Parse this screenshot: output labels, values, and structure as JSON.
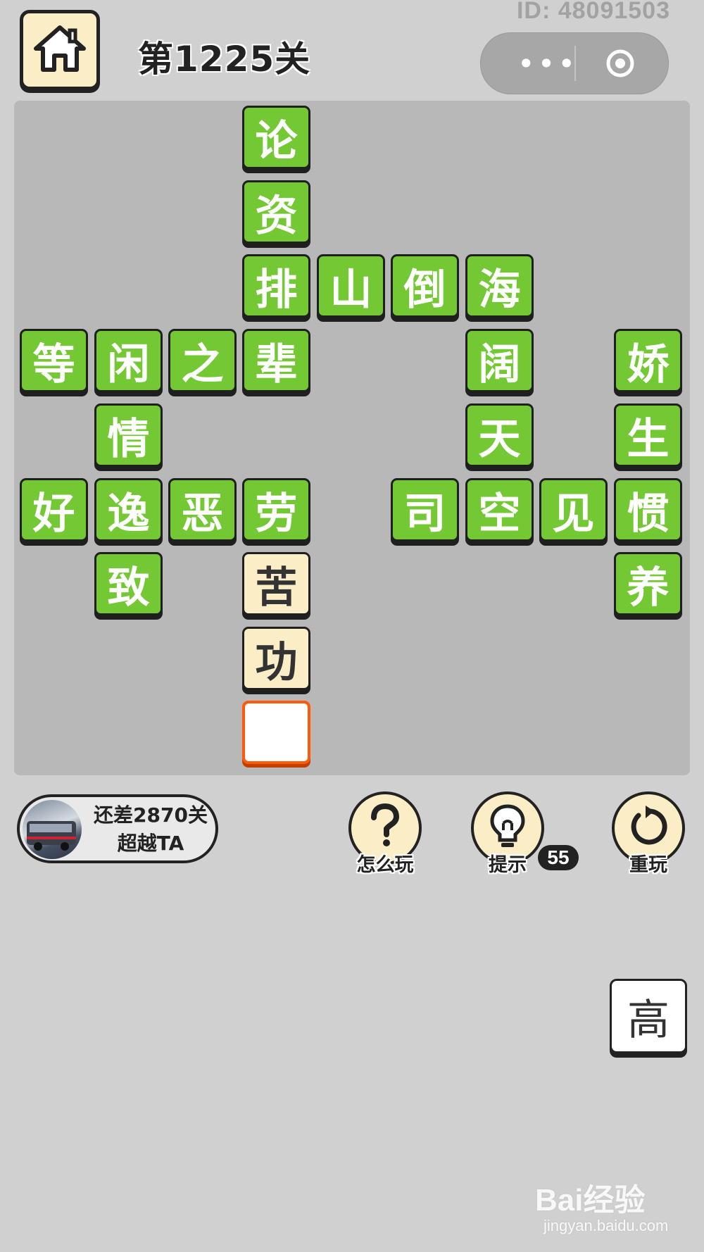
{
  "header": {
    "id_text": "ID: 48091503",
    "level_title": "第1225关",
    "capsule_more": "•••"
  },
  "board": {
    "tiles": [
      {
        "char": "论",
        "state": "filled"
      },
      {
        "char": "资",
        "state": "filled"
      },
      {
        "char": "排",
        "state": "filled"
      },
      {
        "char": "山",
        "state": "filled"
      },
      {
        "char": "倒",
        "state": "filled"
      },
      {
        "char": "海",
        "state": "filled"
      },
      {
        "char": "等",
        "state": "filled"
      },
      {
        "char": "闲",
        "state": "filled"
      },
      {
        "char": "之",
        "state": "filled"
      },
      {
        "char": "辈",
        "state": "filled"
      },
      {
        "char": "阔",
        "state": "filled"
      },
      {
        "char": "娇",
        "state": "filled"
      },
      {
        "char": "情",
        "state": "filled"
      },
      {
        "char": "天",
        "state": "filled"
      },
      {
        "char": "生",
        "state": "filled"
      },
      {
        "char": "好",
        "state": "filled"
      },
      {
        "char": "逸",
        "state": "filled"
      },
      {
        "char": "恶",
        "state": "filled"
      },
      {
        "char": "劳",
        "state": "filled"
      },
      {
        "char": "司",
        "state": "filled"
      },
      {
        "char": "空",
        "state": "filled"
      },
      {
        "char": "见",
        "state": "filled"
      },
      {
        "char": "惯",
        "state": "filled"
      },
      {
        "char": "致",
        "state": "filled"
      },
      {
        "char": "苦",
        "state": "revealed"
      },
      {
        "char": "养",
        "state": "filled"
      },
      {
        "char": "功",
        "state": "revealed"
      },
      {
        "char": "",
        "state": "active-empty"
      }
    ]
  },
  "rank": {
    "line1": "还差2870关",
    "line2": "超越TA"
  },
  "tools": {
    "help_label": "怎么玩",
    "hint_label": "提示",
    "hint_count": "55",
    "replay_label": "重玩"
  },
  "choices": [
    "高"
  ],
  "watermark": {
    "logo": "Bai经验",
    "url": "jingyan.baidu.com"
  },
  "colors": {
    "tile_green": "#73c833",
    "tile_cream": "#fbeec6",
    "active_border": "#ff5a0a",
    "board_bg": "#b8b8b8",
    "page_bg": "#d0d0d0"
  }
}
